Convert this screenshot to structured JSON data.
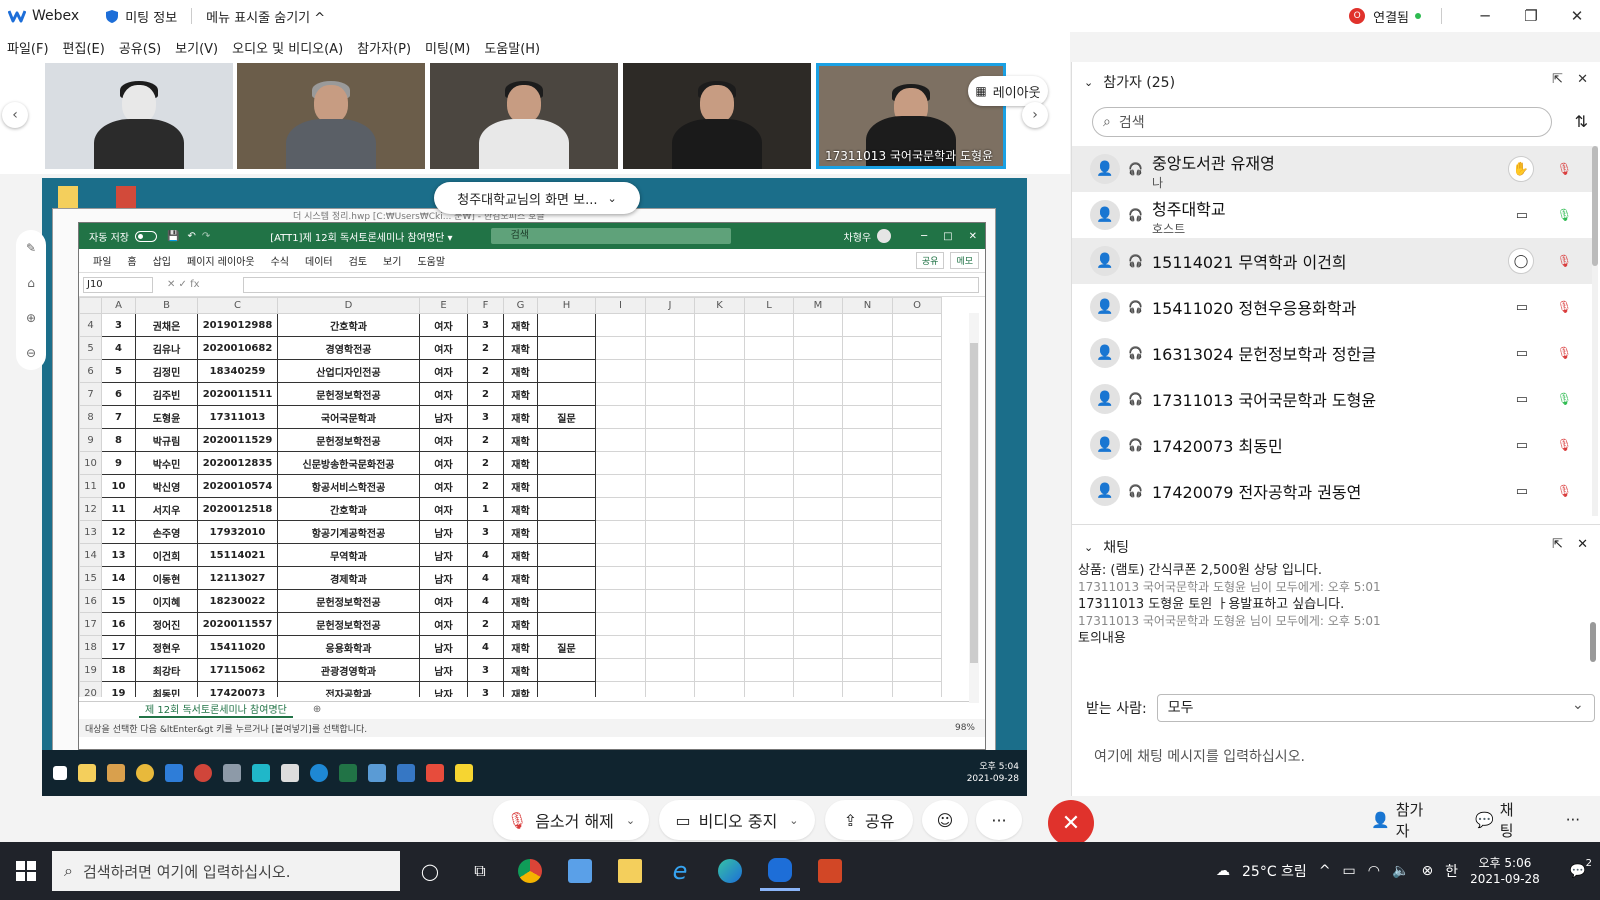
{
  "titlebar": {
    "app_name": "Webex",
    "meeting_info": "미팅 정보",
    "hide_menu": "메뉴 표시줄 숨기기 ^",
    "status": "연결됨",
    "status_badge": "O"
  },
  "menu": [
    "파일(F)",
    "편집(E)",
    "공유(S)",
    "보기(V)",
    "오디오 및 비디오(A)",
    "참가자(P)",
    "미팅(M)",
    "도움말(H)"
  ],
  "video_strip": {
    "active_tile_name": "17311013 국어국문학과 도형윤",
    "layout_label": "레이아웃"
  },
  "share": {
    "banner": "청주대학교님의 화면 보...",
    "hwp_title": "더 시스템 정리.hwp [C:₩Users₩Cki...                                       문₩] - 한컴오피스 호글",
    "excel_title": "[ATT1]제 12회 독서토론세미나 참여명단 ▾",
    "excel_search": "검색",
    "excel_user": "차형우",
    "autosave": "자동 저장",
    "ribbon": [
      "파일",
      "홈",
      "삽입",
      "페이지 레이아웃",
      "수식",
      "데이터",
      "검토",
      "보기",
      "도움말"
    ],
    "ribbon_share": "공유",
    "ribbon_memo": "메모",
    "name_box": "J10",
    "fx": "✕  ✓  fx",
    "columns": [
      "A",
      "B",
      "C",
      "D",
      "E",
      "F",
      "G",
      "H",
      "I",
      "J",
      "K",
      "L",
      "M",
      "N",
      "O"
    ],
    "rows": [
      {
        "r": "4",
        "a": "3",
        "b": "권채은",
        "c": "2019012988",
        "d": "간호학과",
        "e": "여자",
        "f": "3",
        "g": "재학",
        "h": ""
      },
      {
        "r": "5",
        "a": "4",
        "b": "김유나",
        "c": "2020010682",
        "d": "경영학전공",
        "e": "여자",
        "f": "2",
        "g": "재학",
        "h": ""
      },
      {
        "r": "6",
        "a": "5",
        "b": "김정민",
        "c": "18340259",
        "d": "산업디자인전공",
        "e": "여자",
        "f": "2",
        "g": "재학",
        "h": ""
      },
      {
        "r": "7",
        "a": "6",
        "b": "김주빈",
        "c": "2020011511",
        "d": "문헌정보학전공",
        "e": "여자",
        "f": "2",
        "g": "재학",
        "h": ""
      },
      {
        "r": "8",
        "a": "7",
        "b": "도형윤",
        "c": "17311013",
        "d": "국어국문학과",
        "e": "남자",
        "f": "3",
        "g": "재학",
        "h": "질문"
      },
      {
        "r": "9",
        "a": "8",
        "b": "박규림",
        "c": "2020011529",
        "d": "문헌정보학전공",
        "e": "여자",
        "f": "2",
        "g": "재학",
        "h": ""
      },
      {
        "r": "10",
        "a": "9",
        "b": "박수민",
        "c": "2020012835",
        "d": "신문방송한국문화전공",
        "e": "여자",
        "f": "2",
        "g": "재학",
        "h": ""
      },
      {
        "r": "11",
        "a": "10",
        "b": "박신영",
        "c": "2020010574",
        "d": "항공서비스학전공",
        "e": "여자",
        "f": "2",
        "g": "재학",
        "h": ""
      },
      {
        "r": "12",
        "a": "11",
        "b": "서지우",
        "c": "2020012518",
        "d": "간호학과",
        "e": "여자",
        "f": "1",
        "g": "재학",
        "h": ""
      },
      {
        "r": "13",
        "a": "12",
        "b": "손주영",
        "c": "17932010",
        "d": "항공기계공학전공",
        "e": "남자",
        "f": "3",
        "g": "재학",
        "h": ""
      },
      {
        "r": "14",
        "a": "13",
        "b": "이건희",
        "c": "15114021",
        "d": "무역학과",
        "e": "남자",
        "f": "4",
        "g": "재학",
        "h": ""
      },
      {
        "r": "15",
        "a": "14",
        "b": "이동현",
        "c": "12113027",
        "d": "경제학과",
        "e": "남자",
        "f": "4",
        "g": "재학",
        "h": ""
      },
      {
        "r": "16",
        "a": "15",
        "b": "이지혜",
        "c": "18230022",
        "d": "문헌정보학전공",
        "e": "여자",
        "f": "4",
        "g": "재학",
        "h": ""
      },
      {
        "r": "17",
        "a": "16",
        "b": "정어진",
        "c": "2020011557",
        "d": "문헌정보학전공",
        "e": "여자",
        "f": "2",
        "g": "재학",
        "h": ""
      },
      {
        "r": "18",
        "a": "17",
        "b": "정현우",
        "c": "15411020",
        "d": "응용화학과",
        "e": "남자",
        "f": "4",
        "g": "재학",
        "h": "질문"
      },
      {
        "r": "19",
        "a": "18",
        "b": "최강타",
        "c": "17115062",
        "d": "관광경영학과",
        "e": "남자",
        "f": "3",
        "g": "재학",
        "h": ""
      },
      {
        "r": "20",
        "a": "19",
        "b": "최동민",
        "c": "17420073",
        "d": "전자공학과",
        "e": "남자",
        "f": "3",
        "g": "재학",
        "h": ""
      }
    ],
    "sheet_tab": "제 12회 독서토론세미나 참여명단",
    "status_text": "대상을 선택한 다음 &ltEnter&gt 키를 누르거나 [붙여넣기]를 선택합니다.",
    "zoom": "98%",
    "inner_clock_time": "오후 5:04",
    "inner_clock_date": "2021-09-28"
  },
  "participants": {
    "header": "참가자 (25)",
    "search_placeholder": "검색",
    "list": [
      {
        "name": "중앙도서관 유재영",
        "sub": "나",
        "action": "✋",
        "mic": "muted",
        "highlight": true
      },
      {
        "name": "청주대학교",
        "sub": "호스트",
        "action": "▭",
        "mic": "on",
        "highlight": false
      },
      {
        "name": "15114021 무역학과 이건희",
        "sub": "",
        "action": "◯",
        "mic": "muted",
        "highlight": true
      },
      {
        "name": "15411020 정현우응용화학과",
        "sub": "",
        "action": "▭",
        "mic": "muted",
        "highlight": false
      },
      {
        "name": "16313024 문헌정보학과 정한글",
        "sub": "",
        "action": "▭",
        "mic": "muted",
        "highlight": false
      },
      {
        "name": "17311013 국어국문학과 도형윤",
        "sub": "",
        "action": "▭",
        "mic": "on",
        "highlight": false
      },
      {
        "name": "17420073 최동민",
        "sub": "",
        "action": "▭",
        "mic": "muted",
        "highlight": false
      },
      {
        "name": "17420079 전자공학과 권동연",
        "sub": "",
        "action": "▭",
        "mic": "muted",
        "highlight": false
      }
    ]
  },
  "chat": {
    "header": "채팅",
    "lines": [
      {
        "type": "msg",
        "text": "상품: (램토) 간식쿠폰 2,500원 상당 입니다."
      },
      {
        "type": "meta",
        "text": "17311013 국어국문학과 도형윤 님이 모두에게:    오후 5:01"
      },
      {
        "type": "msg",
        "text": "17311013 도형윤 토읜 ㅏ용발표하고 싶습니다."
      },
      {
        "type": "meta",
        "text": "17311013 국어국문학과 도형윤 님이 모두에게:    오후 5:01"
      },
      {
        "type": "msg",
        "text": "토의내용"
      }
    ],
    "recipient_label": "받는 사람:",
    "recipient_value": "모두",
    "input_placeholder": "여기에 채팅 메시지를 입력하십시오."
  },
  "controls": {
    "unmute": "음소거 해제",
    "stop_video": "비디오 중지",
    "share": "공유",
    "more": "···",
    "participants": "참가자",
    "chat": "채팅",
    "more_right": "···"
  },
  "taskbar": {
    "search_placeholder": "검색하려면 여기에 입력하십시오.",
    "weather": "25°C  흐림",
    "time": "오후 5:06",
    "date": "2021-09-28",
    "ime": "한",
    "notif": "2"
  },
  "colors": {
    "excel_green": "#217346",
    "webex_red": "#e0322c",
    "active_blue": "#1aa1e4"
  }
}
